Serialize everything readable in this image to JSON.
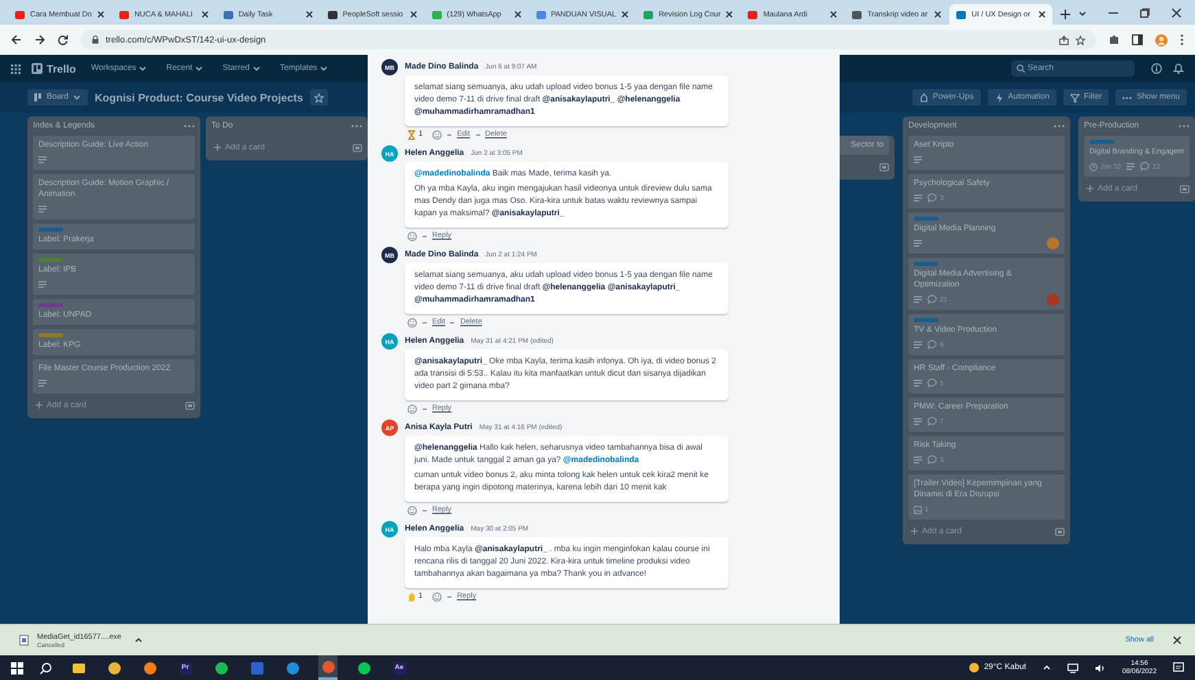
{
  "browser": {
    "tabs": [
      {
        "title": "Cara Membuat Do",
        "color": "#e62117",
        "selected": false
      },
      {
        "title": "NUCA & MAHALI",
        "color": "#e62117",
        "selected": false
      },
      {
        "title": "Daily Task",
        "color": "#3f6fb5",
        "selected": false
      },
      {
        "title": "PeopleSoft sessio",
        "color": "#333333",
        "selected": false
      },
      {
        "title": "(129) WhatsApp",
        "color": "#25b34a",
        "selected": false
      },
      {
        "title": "PANDUAN VISUAL",
        "color": "#4a87e8",
        "selected": false
      },
      {
        "title": "Revision Log Cour",
        "color": "#1fa463",
        "selected": false
      },
      {
        "title": "Maulana Ardi",
        "color": "#e62117",
        "selected": false
      },
      {
        "title": "Transkrip video ar",
        "color": "#555555",
        "selected": false
      },
      {
        "title": "UI / UX Design or",
        "color": "#0079bf",
        "selected": true
      }
    ],
    "address": "trello.com/c/WPwDxST/142-ui-ux-design"
  },
  "trello_nav": {
    "logo": "Trello",
    "menus": [
      "Workspaces",
      "Recent",
      "Starred",
      "Templates"
    ],
    "search": {
      "placeholder": "Search"
    }
  },
  "board_header": {
    "view": "Board",
    "title": "Kognisi Product: Course Video Projects",
    "actions": [
      "Power-Ups",
      "Automation",
      "Filter",
      "Show menu"
    ]
  },
  "left_lists": [
    {
      "title": "Index & Legends",
      "add_card": "Add a card",
      "cards": [
        {
          "title": "Description Guide: Live Action",
          "description": true
        },
        {
          "title": "Description Guide: Motion Graphic / Animation",
          "description": true
        },
        {
          "title": "Label: Prakerja",
          "label": {
            "color": "#1a5c8c"
          },
          "description": false
        },
        {
          "title": "Label: IPB",
          "label": {
            "color": "#4f7d3a"
          },
          "description": true
        },
        {
          "title": "Label: UNPAD",
          "label": {
            "color": "#6c3d8c"
          },
          "description": false
        },
        {
          "title": "Label: KPG",
          "label": {
            "color": "#8c7a26"
          },
          "description": false
        },
        {
          "title": "File Master Course Production 2022",
          "description": true
        }
      ]
    },
    {
      "title": "To Do",
      "add_card": "Add a card"
    }
  ],
  "right_lists": [
    {
      "kind": "partial",
      "cards": [
        {
          "title": "Sector to",
          "description": false
        }
      ]
    },
    {
      "kind": "full",
      "title": "Development",
      "add_card": "Add a card",
      "cards": [
        {
          "title": "Aset Kripto",
          "description": true
        },
        {
          "title": "Psychological Safety",
          "description": true,
          "comments": "3"
        },
        {
          "title": "Digital Media Planning",
          "label": {
            "color": "#1a5c8c"
          },
          "description": true,
          "member": {
            "color": "#b5762a"
          }
        },
        {
          "title": "Digital Media Advertising & Optimization",
          "label": {
            "color": "#1a5c8c"
          },
          "description": true,
          "comments": "21",
          "member": {
            "color": "#a8371d"
          }
        },
        {
          "title": "TV & Video Production",
          "label": {
            "color": "#1a5c8c"
          },
          "description": true,
          "comments": "9"
        },
        {
          "title": "HR Staff - Compliance",
          "description": true,
          "comments": "5"
        },
        {
          "title": "PMW: Career Preparation",
          "description": true,
          "comments": "7"
        },
        {
          "title": "Risk Taking",
          "description": true,
          "comments": "3"
        },
        {
          "title": "[Trailer Video] Kepemimpinan yang Dinamis di Era Disrupsi",
          "description": false,
          "attachments": "1"
        }
      ]
    },
    {
      "kind": "full",
      "title": "Pre-Production",
      "add_card": "Add a card",
      "cards": [
        {
          "title": "Digital Branding & Engagem",
          "label": {
            "color": "#1a5c8c"
          },
          "due": "Jun 10",
          "description": true,
          "comments": "12"
        }
      ]
    }
  ],
  "comments": [
    {
      "author": "Made Dino Balinda",
      "initials": "MB",
      "color": "#1d2b4f",
      "time": "Jun 6 at 9:07 AM",
      "paragraphs": [
        [
          {
            "kind": "text",
            "text": "selamat siang semuanya, aku udah upload video bonus 1-5 yaa dengan file name video demo 7-11 di drive final draft "
          },
          {
            "kind": "mention",
            "text": "@anisakaylaputri_"
          },
          {
            "kind": "mention",
            "text": "@helenanggelia"
          },
          {
            "kind": "mention",
            "text": "@muhammadirhamramadhan1"
          }
        ]
      ],
      "reaction": {
        "kind": "hourglass",
        "count": "1"
      },
      "actions": [
        "Edit",
        "Delete"
      ]
    },
    {
      "author": "Helen Anggelia",
      "initials": "HA",
      "color": "#00a3bf",
      "time": "Jun 2 at 3:05 PM",
      "paragraphs": [
        [
          {
            "kind": "self_mention",
            "text": "@madedinobalinda"
          },
          {
            "kind": "text",
            "text": " Baik mas Made, terima kasih ya."
          }
        ],
        [
          {
            "kind": "text",
            "text": "Oh ya mba Kayla, aku ingin mengajukan hasil videonya untuk direview dulu sama mas Dendy dan juga mas Oso. Kira-kira untuk batas waktu reviewnya sampai kapan ya maksimal? "
          },
          {
            "kind": "mention",
            "text": "@anisakaylaputri_"
          }
        ]
      ],
      "actions": [
        "Reply"
      ]
    },
    {
      "author": "Made Dino Balinda",
      "initials": "MB",
      "color": "#1d2b4f",
      "time": "Jun 2 at 1:24 PM",
      "paragraphs": [
        [
          {
            "kind": "text",
            "text": "selamat siang semuanya, aku udah upload video bonus 1-5 yaa dengan file name video demo 7-11 di drive final draft "
          },
          {
            "kind": "mention",
            "text": "@helenanggelia"
          },
          {
            "kind": "mention",
            "text": "@anisakaylaputri_"
          },
          {
            "kind": "mention",
            "text": "@muhammadirhamramadhan1"
          }
        ]
      ],
      "actions": [
        "Edit",
        "Delete"
      ]
    },
    {
      "author": "Helen Anggelia",
      "initials": "HA",
      "color": "#00a3bf",
      "time": "May 31 at 4:21 PM (edited)",
      "paragraphs": [
        [
          {
            "kind": "mention",
            "text": "@anisakaylaputri_"
          },
          {
            "kind": "text",
            "text": " Oke mba Kayla, terima kasih infonya. Oh iya, di video bonus 2 ada transisi di 5:53.. Kalau itu kita manfaatkan untuk dicut dan sisanya dijadikan video part 2 gimana mba?"
          }
        ]
      ],
      "actions": [
        "Reply"
      ]
    },
    {
      "author": "Anisa Kayla Putri",
      "initials": "AP",
      "color": "#e0452b",
      "time": "May 31 at 4:16 PM (edited)",
      "paragraphs": [
        [
          {
            "kind": "mention",
            "text": "@helenanggelia"
          },
          {
            "kind": "text",
            "text": " Hallo kak helen, seharusnya video tambahannya bisa di awal juni. Made untuk tanggal 2 aman ga ya? "
          },
          {
            "kind": "self_mention",
            "text": "@madedinobalinda"
          }
        ],
        [
          {
            "kind": "text",
            "text": "cuman untuk video bonus 2, aku minta tolong kak helen untuk cek kira2 menit ke berapa yang ingin dipotong materinya, karena lebih dari 10 menit kak"
          }
        ]
      ],
      "actions": [
        "Reply"
      ]
    },
    {
      "author": "Helen Anggelia",
      "initials": "HA",
      "color": "#00a3bf",
      "time": "May 30 at 2:05 PM",
      "paragraphs": [
        [
          {
            "kind": "text",
            "text": "Halo mba Kayla "
          },
          {
            "kind": "mention",
            "text": "@anisakaylaputri_"
          },
          {
            "kind": "text",
            "text": " . mba ku ingin menginfokan kalau course ini rencana rilis di tanggal 20 Juni 2022. Kira-kira untuk timeline produksi video tambahannya akan bagaimana ya mba? Thank you in advance!"
          }
        ]
      ],
      "reaction": {
        "kind": "wave",
        "count": "1"
      },
      "actions": [
        "Reply"
      ]
    }
  ],
  "download": {
    "file": "MediaGet_id16577....exe",
    "status": "Cancelled",
    "show_all": "Show all"
  },
  "taskbar": {
    "apps": [
      {
        "kind": "folder",
        "color": "#f2c13a",
        "active": false
      },
      {
        "kind": "round",
        "color": "#e9b23a",
        "active": false
      },
      {
        "kind": "round",
        "color": "#ff7a1a",
        "active": false
      },
      {
        "kind": "tile",
        "color": "#1f1f5c",
        "label": "Pr",
        "active": false
      },
      {
        "kind": "round",
        "color": "#1db954",
        "active": false
      },
      {
        "kind": "tile",
        "color": "#2b64c8",
        "active": false
      },
      {
        "kind": "round",
        "color": "#1e8fd6",
        "active": false
      },
      {
        "kind": "round",
        "color": "#e4572e",
        "active": true
      },
      {
        "kind": "round",
        "color": "#06c755",
        "active": false
      },
      {
        "kind": "tile",
        "color": "#2a1a5e",
        "label": "Ae",
        "active": false
      }
    ],
    "weather": "29°C Kabut",
    "time": "14:56",
    "date": "08/06/2022"
  }
}
